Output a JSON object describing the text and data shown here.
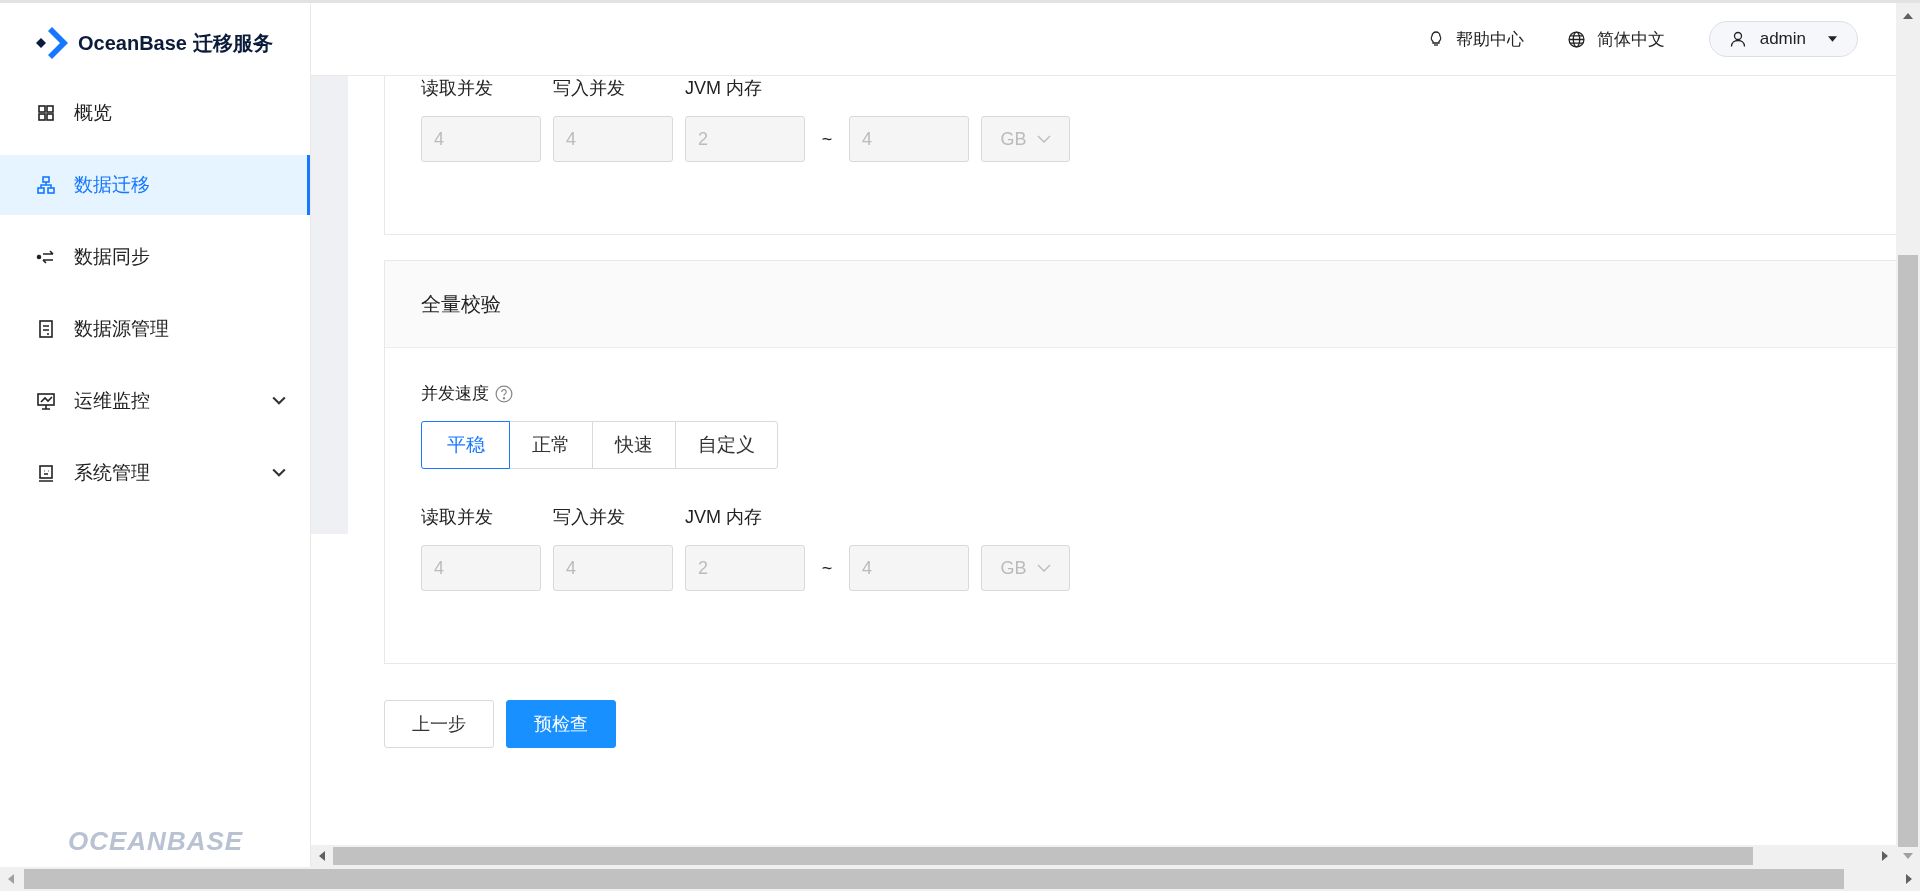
{
  "brand": {
    "name": "OceanBase 迁移服务",
    "footer_logo": "OCEANBASE"
  },
  "sidebar": {
    "items": [
      {
        "label": "概览",
        "selected": false,
        "expandable": false
      },
      {
        "label": "数据迁移",
        "selected": true,
        "expandable": false
      },
      {
        "label": "数据同步",
        "selected": false,
        "expandable": false
      },
      {
        "label": "数据源管理",
        "selected": false,
        "expandable": false
      },
      {
        "label": "运维监控",
        "selected": false,
        "expandable": true
      },
      {
        "label": "系统管理",
        "selected": false,
        "expandable": true
      }
    ]
  },
  "header": {
    "help": "帮助中心",
    "language": "简体中文",
    "user": "admin"
  },
  "sections": [
    {
      "fields": {
        "read_label": "读取并发",
        "write_label": "写入并发",
        "jvm_label": "JVM 内存",
        "read": "4",
        "write": "4",
        "jvm_min": "2",
        "separator": "~",
        "jvm_max": "4",
        "unit": "GB",
        "disabled": true
      }
    },
    {
      "title": "全量校验",
      "speed": {
        "label": "并发速度",
        "options": [
          {
            "label": "平稳",
            "selected": true
          },
          {
            "label": "正常",
            "selected": false
          },
          {
            "label": "快速",
            "selected": false
          },
          {
            "label": "自定义",
            "selected": false
          }
        ]
      },
      "fields": {
        "read_label": "读取并发",
        "write_label": "写入并发",
        "jvm_label": "JVM 内存",
        "read": "4",
        "write": "4",
        "jvm_min": "2",
        "separator": "~",
        "jvm_max": "4",
        "unit": "GB",
        "disabled": true
      }
    }
  ],
  "buttons": [
    {
      "label": "上一步",
      "kind": "default"
    },
    {
      "label": "预检查",
      "kind": "primary"
    }
  ]
}
